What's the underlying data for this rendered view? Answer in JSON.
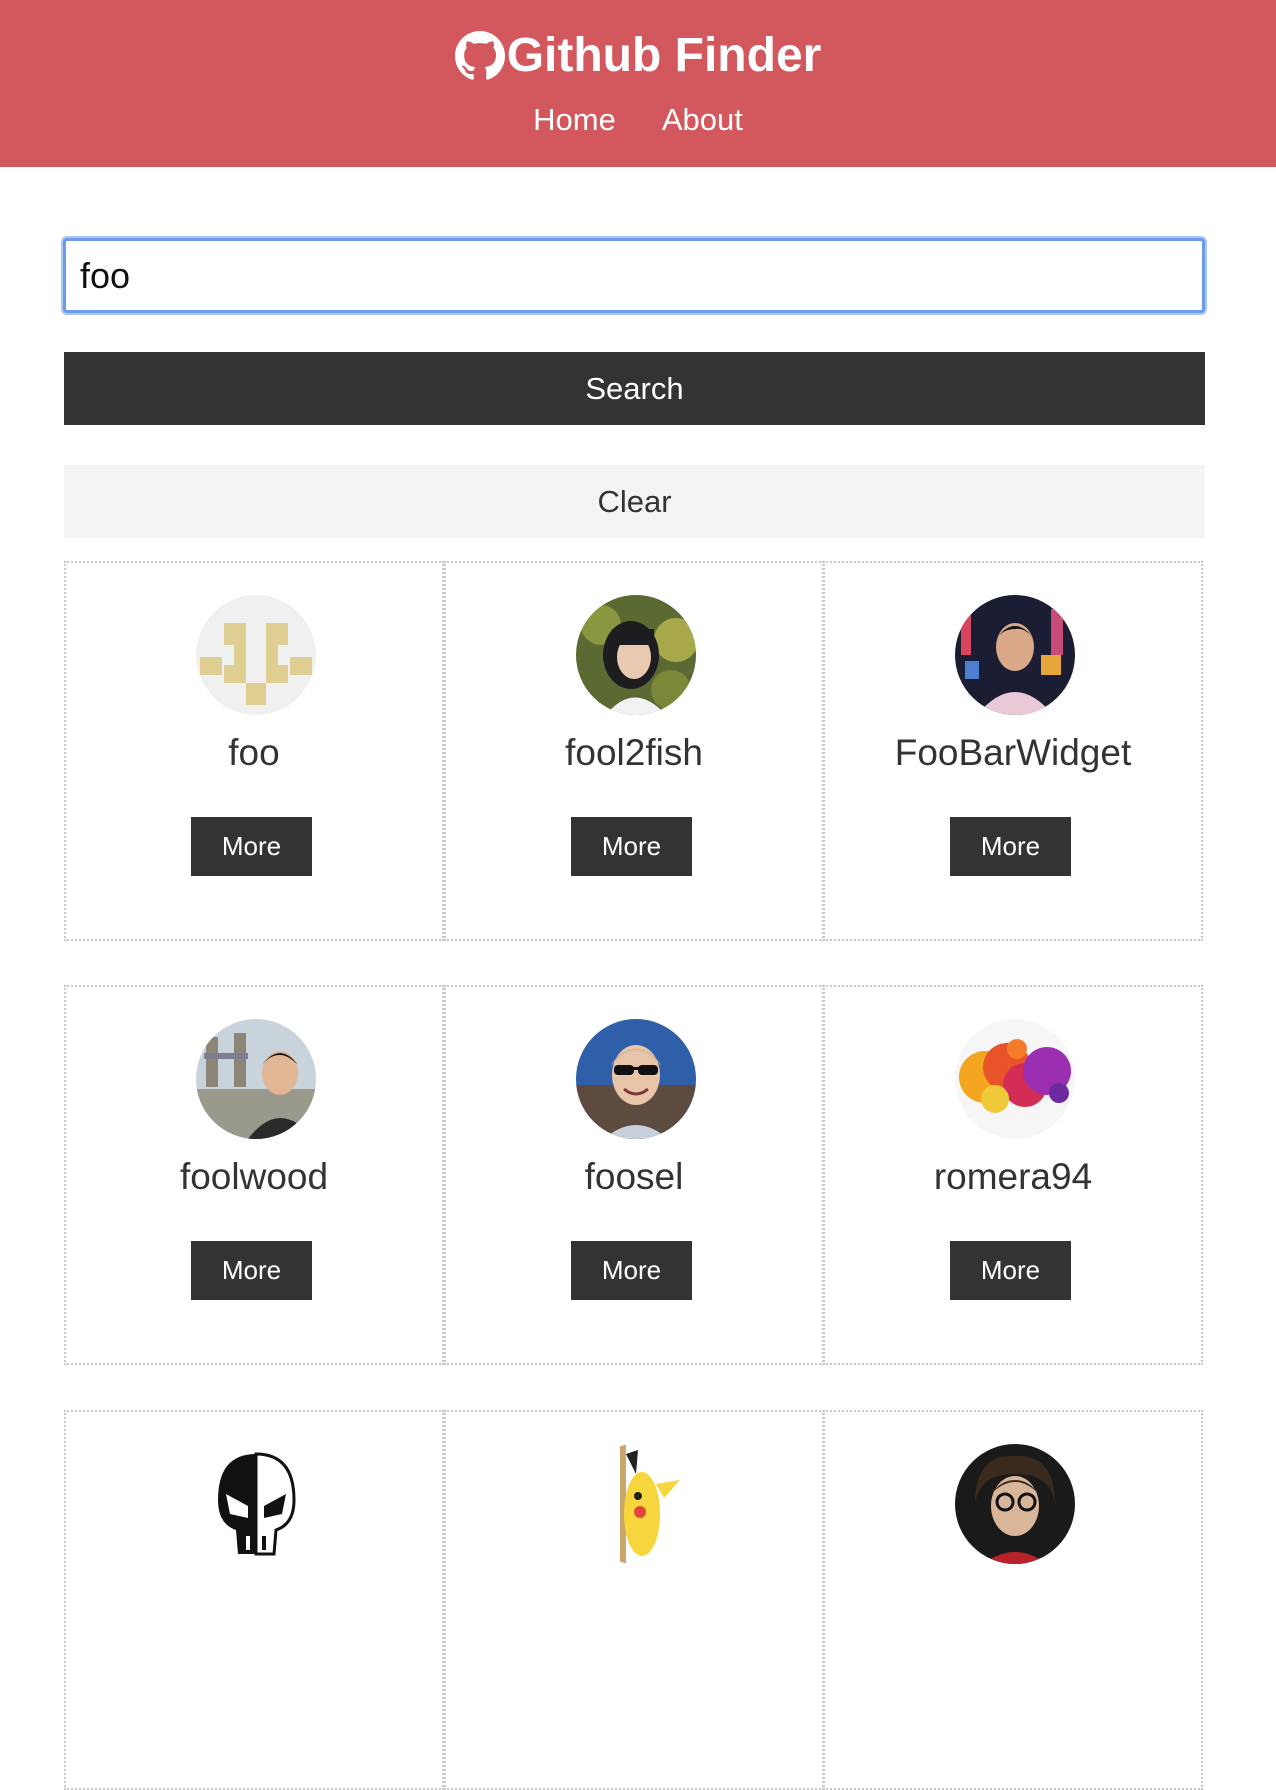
{
  "navbar": {
    "brand_icon": "github-icon",
    "title": "Github Finder",
    "links": [
      "Home",
      "About"
    ]
  },
  "search": {
    "value": "foo",
    "search_label": "Search",
    "clear_label": "Clear"
  },
  "users": [
    {
      "login": "foo",
      "avatar": "identicon-avatar",
      "more_label": "More"
    },
    {
      "login": "fool2fish",
      "avatar": "photo-avatar",
      "more_label": "More"
    },
    {
      "login": "FooBarWidget",
      "avatar": "photo-avatar",
      "more_label": "More"
    },
    {
      "login": "foolwood",
      "avatar": "photo-avatar",
      "more_label": "More"
    },
    {
      "login": "foosel",
      "avatar": "photo-avatar",
      "more_label": "More"
    },
    {
      "login": "romera94",
      "avatar": "paint-splash-avatar",
      "more_label": "More"
    },
    {
      "login": "",
      "avatar": "skull-logo-avatar",
      "more_label": ""
    },
    {
      "login": "",
      "avatar": "pikachu-avatar",
      "more_label": ""
    },
    {
      "login": "",
      "avatar": "photo-avatar",
      "more_label": ""
    }
  ],
  "colors": {
    "navbar": "#d2585d",
    "dark": "#333333",
    "light": "#f4f4f4",
    "focus": "#6e9be8"
  }
}
